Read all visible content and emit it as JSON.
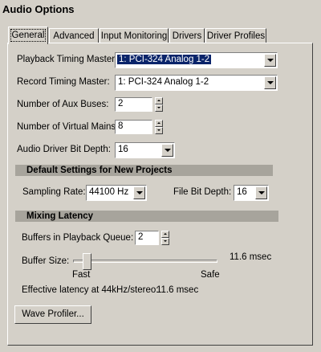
{
  "window": {
    "title": "Audio Options"
  },
  "tabs": [
    {
      "label": "General",
      "active": true
    },
    {
      "label": "Advanced"
    },
    {
      "label": "Input Monitoring"
    },
    {
      "label": "Drivers"
    },
    {
      "label": "Driver Profiles"
    }
  ],
  "general": {
    "playback_master_label": "Playback Timing Master:",
    "playback_master_value": "1: PCI-324 Analog 1-2",
    "record_master_label": "Record Timing Master:",
    "record_master_value": "1: PCI-324 Analog 1-2",
    "aux_buses_label": "Number of Aux Buses:",
    "aux_buses_value": "2",
    "virtual_mains_label": "Number of Virtual Mains:",
    "virtual_mains_value": "8",
    "bit_depth_label": "Audio Driver Bit Depth:",
    "bit_depth_value": "16"
  },
  "defaults": {
    "section_title": "Default Settings for New Projects",
    "sampling_rate_label": "Sampling Rate:",
    "sampling_rate_value": "44100 Hz",
    "file_bit_depth_label": "File Bit Depth:",
    "file_bit_depth_value": "16"
  },
  "latency": {
    "section_title": "Mixing Latency",
    "buffers_label": "Buffers in Playback Queue:",
    "buffers_value": "2",
    "buffer_size_label": "Buffer Size:",
    "buffer_size_readout": "11.6 msec",
    "slider_min_label": "Fast",
    "slider_max_label": "Safe",
    "slider_position": 0.07,
    "effective_label": "Effective latency at 44kHz/stereo:",
    "effective_value": "11.6 msec"
  },
  "buttons": {
    "wave_profiler": "Wave Profiler..."
  }
}
